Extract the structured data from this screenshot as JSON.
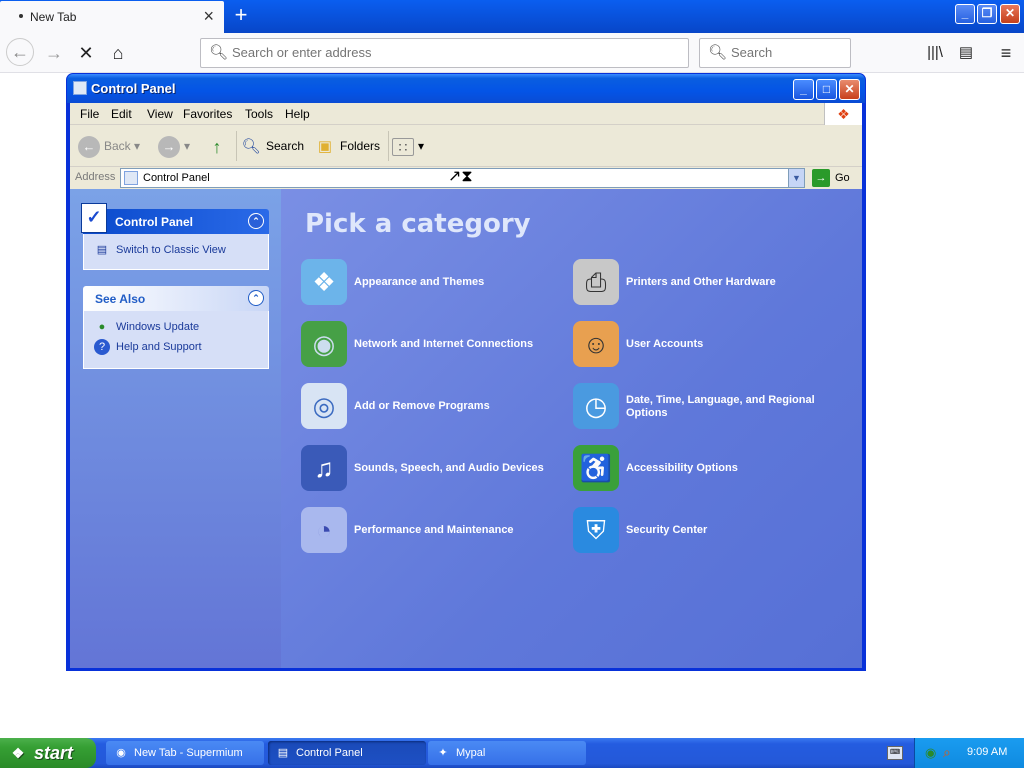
{
  "browser": {
    "tab_title": "New Tab",
    "tab_close": "×",
    "new_tab": "+",
    "win_min": "_",
    "win_max": "❐",
    "win_close": "✕",
    "url_placeholder": "Search or enter address",
    "search_placeholder": "Search",
    "back": "←",
    "forward": "→",
    "stop": "✕",
    "home": "⌂",
    "library": "|||\\",
    "sidebar": "▤",
    "menu": "≡"
  },
  "window": {
    "title": "Control Panel",
    "min": "_",
    "max": "□",
    "close": "✕"
  },
  "menubar": {
    "items": [
      "File",
      "Edit",
      "View",
      "Favorites",
      "Tools",
      "Help"
    ]
  },
  "toolbar": {
    "back": "Back",
    "search": "Search",
    "folders": "Folders"
  },
  "address": {
    "label": "Address",
    "value": "Control Panel",
    "go": "Go"
  },
  "leftpane": {
    "control_panel": {
      "title": "Control Panel",
      "link": "Switch to Classic View"
    },
    "see_also": {
      "title": "See Also",
      "links": [
        "Windows Update",
        "Help and Support"
      ]
    }
  },
  "main": {
    "heading": "Pick a category",
    "categories": [
      {
        "label": "Appearance and Themes",
        "icon": "appearance-icon"
      },
      {
        "label": "Printers and Other Hardware",
        "icon": "printer-icon"
      },
      {
        "label": "Network and Internet Connections",
        "icon": "network-icon"
      },
      {
        "label": "User Accounts",
        "icon": "users-icon"
      },
      {
        "label": "Add or Remove Programs",
        "icon": "add-remove-icon"
      },
      {
        "label": "Date, Time, Language, and Regional Options",
        "icon": "date-time-icon"
      },
      {
        "label": "Sounds, Speech, and Audio Devices",
        "icon": "sound-icon"
      },
      {
        "label": "Accessibility Options",
        "icon": "accessibility-icon"
      },
      {
        "label": "Performance and Maintenance",
        "icon": "performance-icon"
      },
      {
        "label": "Security Center",
        "icon": "shield-icon"
      }
    ]
  },
  "taskbar": {
    "start": "start",
    "tasks": [
      "New Tab - Supermium",
      "Control Panel",
      "Mypal"
    ],
    "clock": "9:09 AM"
  }
}
